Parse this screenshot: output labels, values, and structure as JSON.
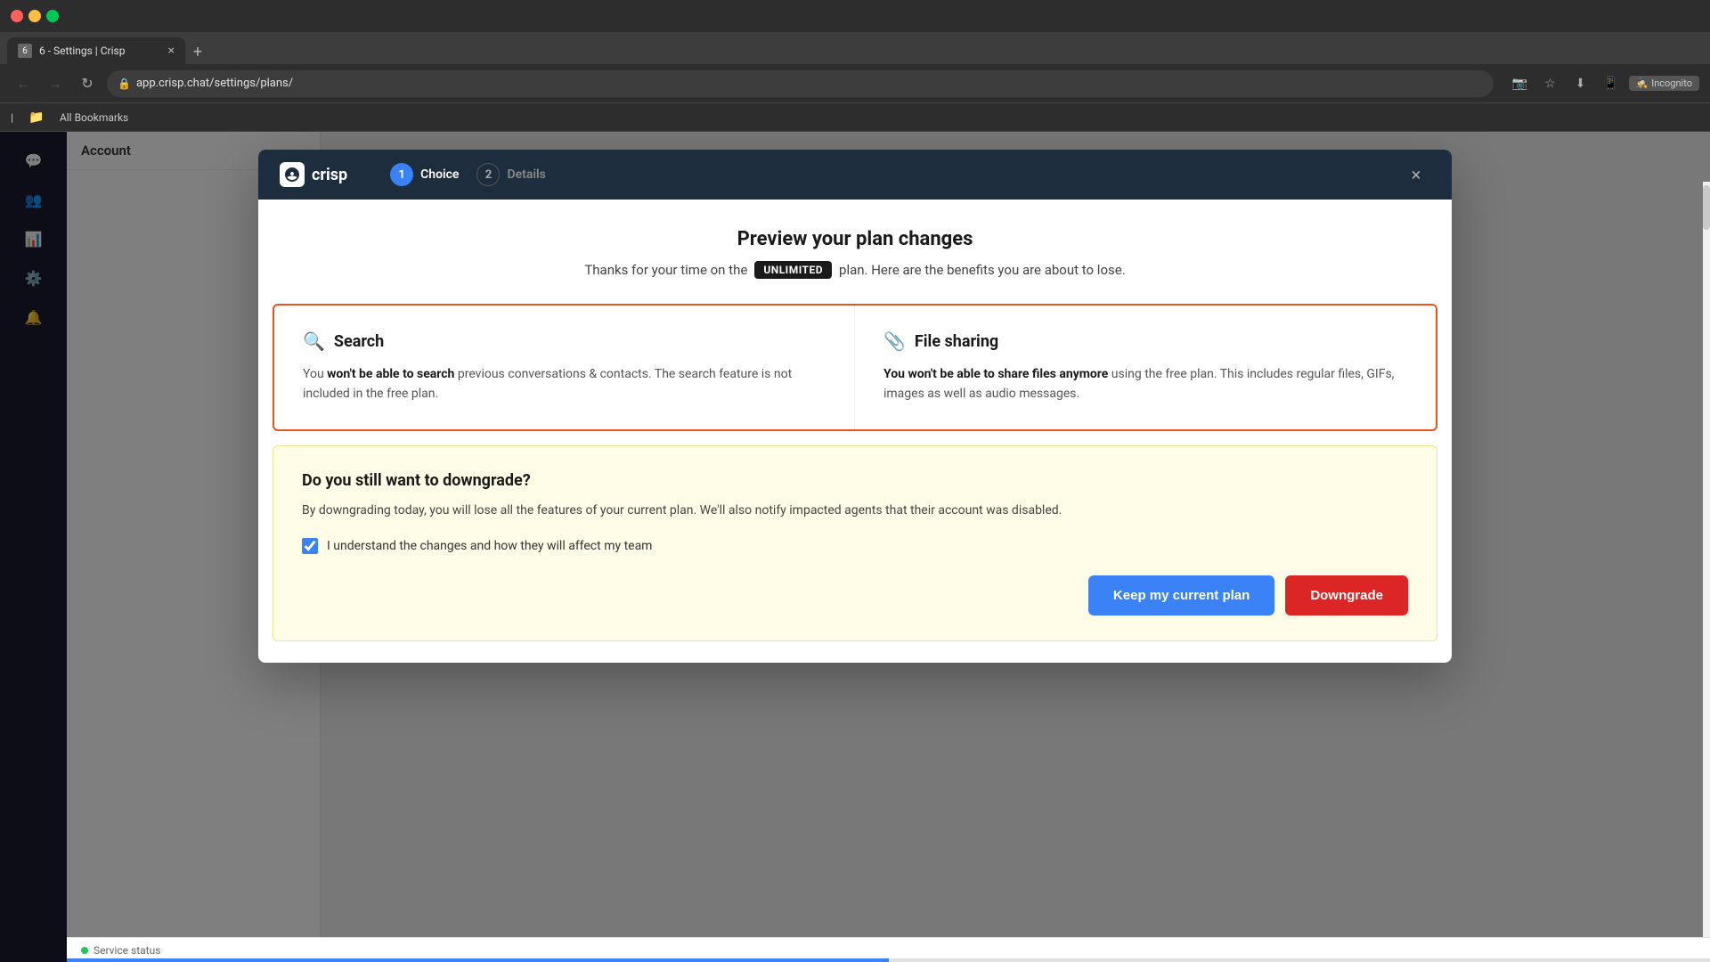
{
  "browser": {
    "url": "app.crisp.chat/settings/plans/",
    "tab_title": "6 - Settings | Crisp",
    "incognito_label": "Incognito",
    "bookmarks_label": "All Bookmarks"
  },
  "modal": {
    "logo_text": "crisp",
    "close_label": "×",
    "steps": [
      {
        "number": "1",
        "label": "Choice",
        "active": true
      },
      {
        "number": "2",
        "label": "Details",
        "active": false
      }
    ],
    "preview": {
      "title": "Preview your plan changes",
      "subtitle_before": "Thanks for your time on the",
      "plan_badge": "UNLIMITED",
      "subtitle_after": "plan. Here are the benefits you are about to lose."
    },
    "features": [
      {
        "icon": "🔍",
        "icon_name": "search",
        "name": "Search",
        "description_parts": [
          {
            "text": "You ",
            "bold": false
          },
          {
            "text": "won't be able to search",
            "bold": true
          },
          {
            "text": " previous conversations & contacts. The search feature is not included in the free plan.",
            "bold": false
          }
        ],
        "description_full": "You won't be able to search previous conversations & contacts. The search feature is not included in the free plan."
      },
      {
        "icon": "📎",
        "icon_name": "paperclip",
        "name": "File sharing",
        "description_parts": [
          {
            "text": "You won't be able to share files anymore",
            "bold": true
          },
          {
            "text": " using the free plan. This includes regular files, GIFs, images as well as audio messages.",
            "bold": false
          }
        ],
        "description_full": "You won't be able to share files anymore using the free plan. This includes regular files, GIFs, images as well as audio messages."
      }
    ],
    "downgrade_section": {
      "title": "Do you still want to downgrade?",
      "description": "By downgrading today, you will lose all the features of your current plan. We'll also notify impacted agents that their account was disabled.",
      "checkbox_label": "I understand the changes and how they will affect my team",
      "checkbox_checked": true,
      "btn_keep": "Keep my current plan",
      "btn_downgrade": "Downgrade"
    }
  },
  "sidebar": {
    "icons": [
      "💬",
      "👥",
      "📊",
      "⚙️",
      "🔔"
    ]
  },
  "status_bar": {
    "text": "Service status"
  }
}
